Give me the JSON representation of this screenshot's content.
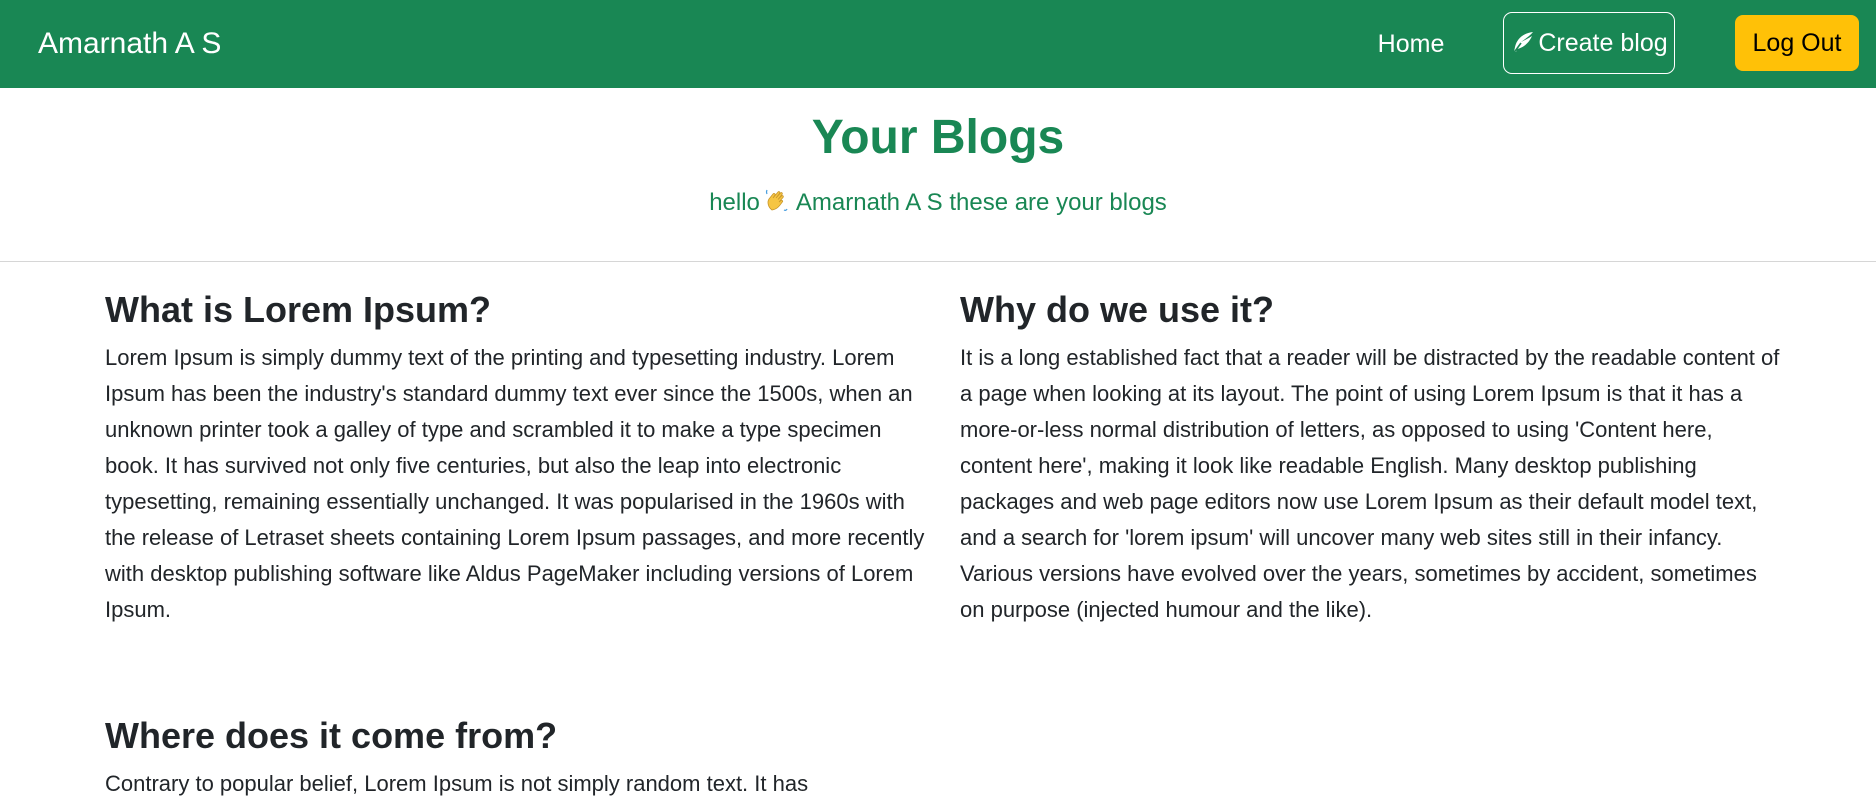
{
  "navbar": {
    "brand": "Amarnath A S",
    "home_label": "Home",
    "create_label": "Create blog",
    "create_icon": "feather-icon",
    "logout_label": "Log Out",
    "colors": {
      "navbar_bg": "#198754",
      "logout_bg": "#ffc107"
    }
  },
  "header": {
    "title": "Your Blogs",
    "greeting_prefix": "hello",
    "greeting_emoji": "waving-hand-icon",
    "greeting_suffix": "Amarnath A S these are your blogs"
  },
  "blogs": [
    {
      "title": "What is Lorem Ipsum?",
      "body": "Lorem Ipsum is simply dummy text of the printing and typesetting industry. Lorem Ipsum has been the industry's standard dummy text ever since the 1500s, when an unknown printer took a galley of type and scrambled it to make a type specimen book. It has survived not only five centuries, but also the leap into electronic typesetting, remaining essentially unchanged. It was popularised in the 1960s with the release of Letraset sheets containing Lorem Ipsum passages, and more recently with desktop publishing software like Aldus PageMaker including versions of Lorem Ipsum."
    },
    {
      "title": "Why do we use it?",
      "body": "It is a long established fact that a reader will be distracted by the readable content of a page when looking at its layout. The point of using Lorem Ipsum is that it has a more-or-less normal distribution of letters, as opposed to using 'Content here, content here', making it look like readable English. Many desktop publishing packages and web page editors now use Lorem Ipsum as their default model text, and a search for 'lorem ipsum' will uncover many web sites still in their infancy. Various versions have evolved over the years, sometimes by accident, sometimes on purpose (injected humour and the like)."
    },
    {
      "title": "Where does it come from?",
      "body": "Contrary to popular belief, Lorem Ipsum is not simply random text. It has"
    }
  ]
}
